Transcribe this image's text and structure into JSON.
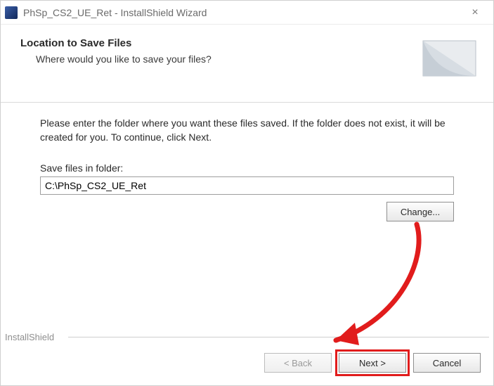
{
  "titlebar": {
    "text": "PhSp_CS2_UE_Ret - InstallShield Wizard"
  },
  "header": {
    "title": "Location to Save Files",
    "subtitle": "Where would you like to save your files?"
  },
  "content": {
    "instruction": "Please enter the folder where you want these files saved.  If the folder does not exist, it will be created for you.   To continue, click Next.",
    "field_label": "Save files in folder:",
    "path_value": "C:\\PhSp_CS2_UE_Ret",
    "change_label": "Change..."
  },
  "footer": {
    "brand": "InstallShield",
    "back_label": "< Back",
    "next_label": "Next >",
    "cancel_label": "Cancel"
  }
}
